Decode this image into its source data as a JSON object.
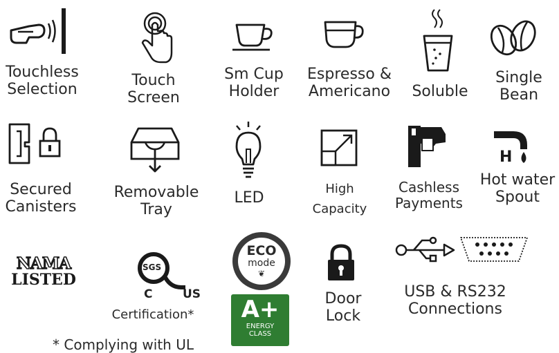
{
  "features": {
    "touchless": {
      "line1": "Touchless",
      "line2": "Selection",
      "icon": "hand-pointing-icon"
    },
    "touchscreen": {
      "line1": "Touch",
      "line2": "Screen",
      "icon": "finger-touch-icon"
    },
    "cup_holder": {
      "line1": "Sm Cup",
      "line2": "Holder",
      "icon": "cup-saucer-icon"
    },
    "espresso": {
      "line1": "Espresso &",
      "line2": "Americano",
      "icon": "espresso-cup-icon"
    },
    "soluble": {
      "line1": "Soluble",
      "icon": "steaming-glass-icon"
    },
    "single_bean": {
      "line1": "Single",
      "line2": "Bean",
      "icon": "coffee-beans-icon"
    },
    "canisters": {
      "line1": "Secured",
      "line2": "Canisters",
      "icon": "canister-lock-icon"
    },
    "tray": {
      "line1": "Removable",
      "line2": "Tray",
      "icon": "tray-arrow-icon"
    },
    "led": {
      "line1": "LED",
      "icon": "lightbulb-icon"
    },
    "capacity": {
      "line1": "High",
      "line2": "Capacity",
      "icon": "expand-square-icon"
    },
    "cashless": {
      "line1": "Cashless",
      "line2": "Payments",
      "icon": "card-reader-icon"
    },
    "hot_water": {
      "line1": "Hot water",
      "line2": "Spout",
      "icon": "hot-water-faucet-icon"
    },
    "door_lock": {
      "line1": "Door",
      "line2": "Lock",
      "icon": "padlock-icon"
    },
    "connections": {
      "line1": "USB &  RS232",
      "line2": "Connections",
      "icons": [
        "usb-icon",
        "serial-port-icon"
      ]
    }
  },
  "badges": {
    "nama": {
      "line1": "NAMA",
      "line2": "LISTED"
    },
    "sgs": {
      "mark": "SGS",
      "c": "C",
      "us": "US",
      "caption": "Certification*"
    },
    "eco": {
      "line1": "ECO",
      "line2": "mode"
    },
    "energy": {
      "grade": "A+",
      "line1": "ENERGY",
      "line2": "CLASS"
    }
  },
  "footnote": "* Complying with UL",
  "colors": {
    "icon": "#1a1a1a",
    "text": "#2a2a2a",
    "energy_green": "#2f7d32"
  }
}
